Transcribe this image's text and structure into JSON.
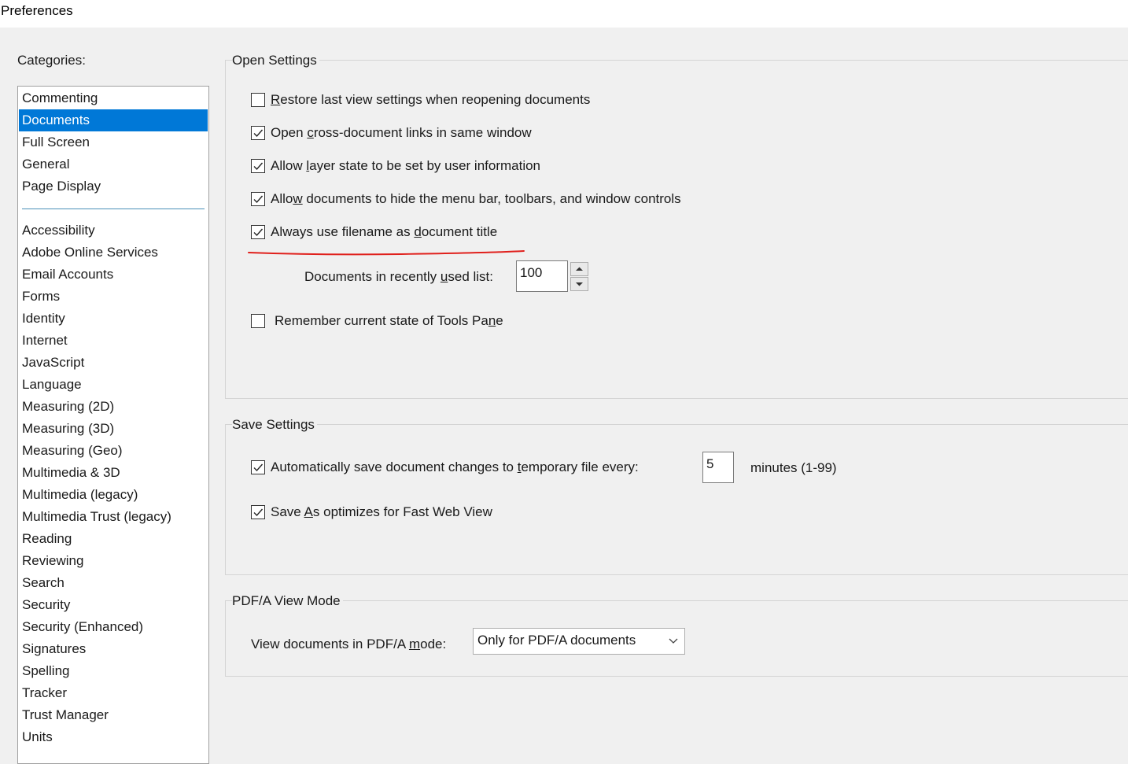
{
  "window": {
    "title": "Preferences"
  },
  "categories": {
    "label": "Categories:",
    "items_top": [
      "Commenting",
      "Documents",
      "Full Screen",
      "General",
      "Page Display"
    ],
    "items_bottom": [
      "Accessibility",
      "Adobe Online Services",
      "Email Accounts",
      "Forms",
      "Identity",
      "Internet",
      "JavaScript",
      "Language",
      "Measuring (2D)",
      "Measuring (3D)",
      "Measuring (Geo)",
      "Multimedia & 3D",
      "Multimedia (legacy)",
      "Multimedia Trust (legacy)",
      "Reading",
      "Reviewing",
      "Search",
      "Security",
      "Security (Enhanced)",
      "Signatures",
      "Spelling",
      "Tracker",
      "Trust Manager",
      "Units"
    ],
    "selected": "Documents"
  },
  "open_settings": {
    "title": "Open Settings",
    "restore_last_view": {
      "label": "Restore last view settings when reopening documents",
      "checked": false
    },
    "cross_doc_links": {
      "label": "Open cross-document links in same window",
      "checked": true
    },
    "layer_state": {
      "label": "Allow layer state to be set by user information",
      "checked": true
    },
    "hide_menu": {
      "label": "Allow documents to hide the menu bar, toolbars, and window controls",
      "checked": true
    },
    "filename_title": {
      "label": "Always use filename as document title",
      "checked": true
    },
    "recent_list": {
      "label": "Documents in recently used list:",
      "value": "100"
    },
    "tools_pane": {
      "label": "Remember current state of Tools Pane",
      "checked": false
    }
  },
  "save_settings": {
    "title": "Save Settings",
    "autosave": {
      "label": "Automatically save document changes to temporary file every:",
      "checked": true,
      "value": "5",
      "suffix": "minutes (1-99)"
    },
    "fast_web_view": {
      "label": "Save As optimizes for Fast Web View",
      "checked": true
    }
  },
  "pdfa": {
    "title": "PDF/A View Mode",
    "label": "View documents in PDF/A mode:",
    "selected": "Only for PDF/A documents"
  },
  "annotation": {
    "color": "#e0201c"
  },
  "colors": {
    "selection": "#0078d7",
    "background": "#f0f0f0"
  }
}
